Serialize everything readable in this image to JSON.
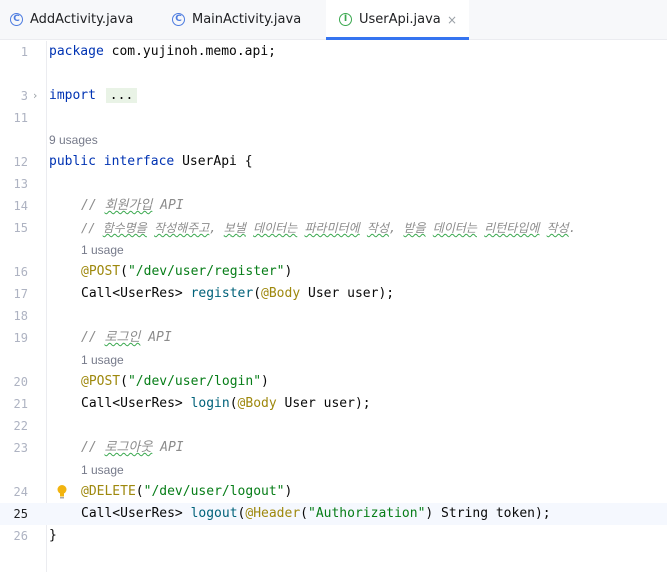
{
  "tabs": [
    {
      "label": "AddActivity.java",
      "icon": "class-icon",
      "icon_glyph": "C",
      "active": false
    },
    {
      "label": "MainActivity.java",
      "icon": "class-icon",
      "icon_glyph": "C",
      "active": false
    },
    {
      "label": "UserApi.java",
      "icon": "interface-icon",
      "icon_glyph": "I",
      "active": true
    }
  ],
  "close_glyph": "×",
  "lines": {
    "n1": "1",
    "n3": "3",
    "n11": "11",
    "n12": "12",
    "n13": "13",
    "n14": "14",
    "n15": "15",
    "n16": "16",
    "n17": "17",
    "n18": "18",
    "n19": "19",
    "n20": "20",
    "n21": "21",
    "n22": "22",
    "n23": "23",
    "n24": "24",
    "n25": "25",
    "n26": "26"
  },
  "code": {
    "pkg_kw": "package",
    "pkg_name": " com.yujinoh.memo.api;",
    "import_kw": "import",
    "import_folded": "...",
    "usages_iface": "9 usages",
    "public_kw": "public",
    "interface_kw": "interface",
    "iface_name": " UserApi {",
    "c14_prefix": "// ",
    "c14_word": "회원가입",
    "c14_suffix": " API",
    "c15_prefix": "// ",
    "c15_w1": "함수명을",
    "c15_sp1": " ",
    "c15_w2": "작성해주고",
    "c15_mid1": ", ",
    "c15_w3": "보낼",
    "c15_sp2": " ",
    "c15_w4": "데이터는",
    "c15_sp3": " ",
    "c15_w5": "파라미터에",
    "c15_sp4": " ",
    "c15_w6": "작성",
    "c15_mid2": ", ",
    "c15_w7": "받을",
    "c15_sp5": " ",
    "c15_w8": "데이터는",
    "c15_sp6": " ",
    "c15_w9": "리턴타입에",
    "c15_sp7": " ",
    "c15_w10": "작성",
    "c15_end": ".",
    "usage1": "1 usage",
    "usage2": "1 usage",
    "usage3": "1 usage",
    "ann_post": "@POST",
    "post_open": "(",
    "path_register": "\"/dev/user/register\"",
    "paren_close": ")",
    "call_type": "Call<UserRes> ",
    "fn_register": "register",
    "p_open": "(",
    "ann_body": "@Body",
    "user_param": " User user);",
    "c19_prefix": "// ",
    "c19_word": "로그인",
    "c19_suffix": " API",
    "ann_post2": "@POST",
    "post_open2": "(",
    "path_login": "\"/dev/user/login\"",
    "paren_close2": ")",
    "call_type2": "Call<UserRes> ",
    "fn_login": "login",
    "p_open2": "(",
    "ann_body2": "@Body",
    "user_param2": " User user);",
    "c23_prefix": "// ",
    "c23_word": "로그아웃",
    "c23_suffix": " API",
    "ann_delete": "@DELETE",
    "del_open": "(",
    "path_logout": "\"/dev/user/logout\"",
    "paren_close3": ")",
    "call_type3": "Call<UserRes> ",
    "fn_logout": "logout",
    "p_open3": "(",
    "ann_header": "@Header",
    "h_open": "(",
    "str_auth": "\"Authorization\"",
    "token_param": ") String token);",
    "close_brace": "}"
  },
  "colors": {
    "keyword": "#0033b3",
    "function": "#00627a",
    "string": "#067d17",
    "annotation": "#9e880d",
    "comment": "#8c8c8c",
    "active_tab_underline": "#3574f0",
    "bulb": "#f2b40f"
  }
}
